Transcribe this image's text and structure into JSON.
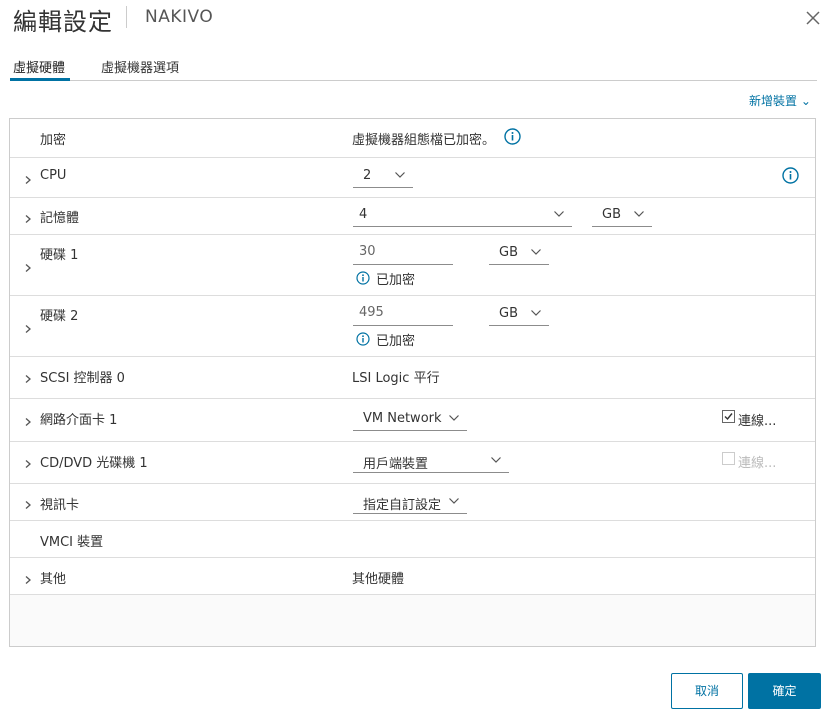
{
  "dialog": {
    "title": "編輯設定",
    "vm_name": "NAKIVO",
    "tabs": [
      {
        "label": "虛擬硬體",
        "active": true
      },
      {
        "label": "虛擬機器選項",
        "active": false
      }
    ],
    "add_device_label": "新增裝置 ⌄"
  },
  "hardware": {
    "encryption": {
      "label": "加密",
      "value": "虛擬機器組態檔已加密。"
    },
    "cpu": {
      "label": "CPU",
      "value": "2"
    },
    "memory": {
      "label": "記憶體",
      "value": "4",
      "unit": "GB"
    },
    "disk1": {
      "label": "硬碟 1",
      "value": "30",
      "unit": "GB",
      "note": "已加密"
    },
    "disk2": {
      "label": "硬碟 2",
      "value": "495",
      "unit": "GB",
      "note": "已加密"
    },
    "scsi": {
      "label": "SCSI 控制器 0",
      "value": "LSI Logic 平行"
    },
    "nic": {
      "label": "網路介面卡 1",
      "value": "VM Network",
      "connect_label": "連線...",
      "connected": true
    },
    "cddvd": {
      "label": "CD/DVD 光碟機 1",
      "value": "用戶端裝置",
      "connect_label": "連線...",
      "connected": false,
      "disabled": true
    },
    "video": {
      "label": "視訊卡",
      "value": "指定自訂設定"
    },
    "vmci": {
      "label": "VMCI 裝置"
    },
    "other": {
      "label": "其他",
      "value": "其他硬體"
    }
  },
  "footer": {
    "cancel_label": "取消",
    "ok_label": "確定"
  },
  "colors": {
    "accent": "#0072a3",
    "border": "#cccccc",
    "text": "#333333"
  },
  "icons": [
    "close-icon",
    "chevron-right-icon",
    "chevron-down-icon",
    "info-icon",
    "checkbox-checked-icon"
  ]
}
